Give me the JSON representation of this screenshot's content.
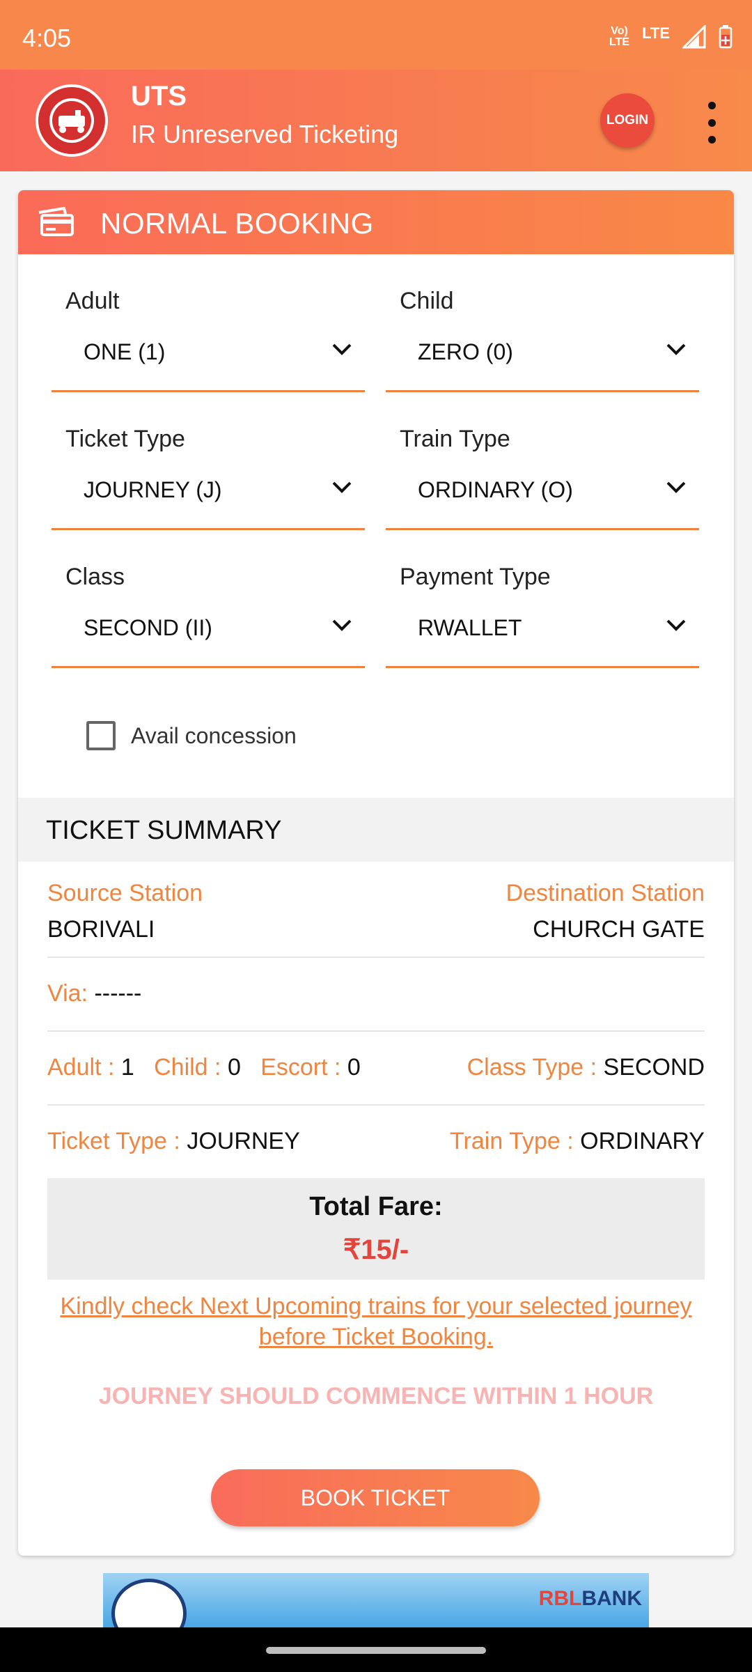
{
  "status_bar": {
    "time": "4:05",
    "volte_top": "Vo)",
    "volte_bottom": "LTE",
    "network": "LTE"
  },
  "app_bar": {
    "title": "UTS",
    "subtitle": "IR Unreserved Ticketing",
    "login_label": "LOGIN"
  },
  "card": {
    "title": "NORMAL BOOKING",
    "fields": {
      "adult": {
        "label": "Adult",
        "value": "ONE (1)"
      },
      "child": {
        "label": "Child",
        "value": "ZERO (0)"
      },
      "ticket_type": {
        "label": "Ticket Type",
        "value": "JOURNEY (J)"
      },
      "train_type": {
        "label": "Train Type",
        "value": "ORDINARY (O)"
      },
      "class": {
        "label": "Class",
        "value": "SECOND (II)"
      },
      "payment_type": {
        "label": "Payment Type",
        "value": "RWALLET"
      }
    },
    "concession_label": "Avail concession"
  },
  "summary": {
    "heading": "TICKET SUMMARY",
    "source_label": "Source Station",
    "source_value": "BORIVALI",
    "destination_label": "Destination Station",
    "destination_value": "CHURCH GATE",
    "via_label": "Via:",
    "via_value": "------",
    "adult_label": "Adult :",
    "adult_value": "1",
    "child_label": "Child :",
    "child_value": "0",
    "escort_label": "Escort :",
    "escort_value": "0",
    "class_type_label": "Class Type :",
    "class_type_value": "SECOND",
    "ticket_type_label": "Ticket Type :",
    "ticket_type_value": "JOURNEY",
    "train_type_label": "Train Type :",
    "train_type_value": "ORDINARY",
    "total_fare_label": "Total Fare:",
    "total_fare_value": "₹15/-",
    "notice": "Kindly check Next Upcoming trains for your selected journey before Ticket Booking.",
    "warning": "JOURNEY SHOULD COMMENCE WITHIN 1 HOUR",
    "book_button": "BOOK TICKET"
  },
  "banner": {
    "bank_name_red": "RBL",
    "bank_name_blue": "BANK"
  },
  "colors": {
    "accent": "#f7874b",
    "line": "#f0813c",
    "label_orange": "#f08540",
    "fare_red": "#e2453c"
  }
}
